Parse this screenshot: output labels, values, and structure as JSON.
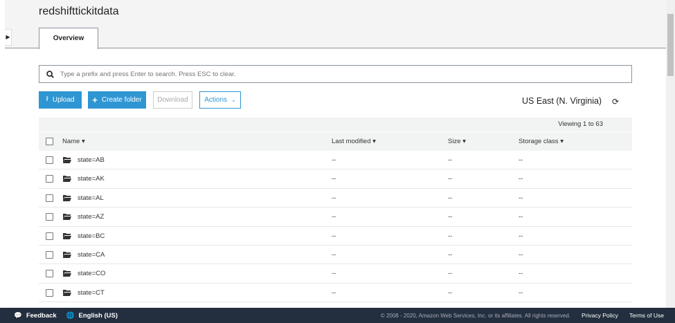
{
  "bucket": {
    "title": "redshifttickitdata",
    "tab": "Overview"
  },
  "search": {
    "placeholder": "Type a prefix and press Enter to search. Press ESC to clear."
  },
  "toolbar": {
    "upload": "Upload",
    "create_folder": "Create folder",
    "download": "Download",
    "actions": "Actions",
    "region": "US East (N. Virginia)"
  },
  "table": {
    "viewing": "Viewing 1 to 63",
    "columns": {
      "name": "Name",
      "last_modified": "Last modified",
      "size": "Size",
      "storage_class": "Storage class"
    },
    "rows": [
      {
        "name": "state=AB",
        "modified": "--",
        "size": "--",
        "storage": "--"
      },
      {
        "name": "state=AK",
        "modified": "--",
        "size": "--",
        "storage": "--"
      },
      {
        "name": "state=AL",
        "modified": "--",
        "size": "--",
        "storage": "--"
      },
      {
        "name": "state=AZ",
        "modified": "--",
        "size": "--",
        "storage": "--"
      },
      {
        "name": "state=BC",
        "modified": "--",
        "size": "--",
        "storage": "--"
      },
      {
        "name": "state=CA",
        "modified": "--",
        "size": "--",
        "storage": "--"
      },
      {
        "name": "state=CO",
        "modified": "--",
        "size": "--",
        "storage": "--"
      },
      {
        "name": "state=CT",
        "modified": "--",
        "size": "--",
        "storage": "--"
      }
    ]
  },
  "footer": {
    "feedback": "Feedback",
    "language": "English (US)",
    "copyright": "© 2008 - 2020, Amazon Web Services, Inc. or its affiliates. All rights reserved.",
    "privacy": "Privacy Policy",
    "terms": "Terms of Use"
  }
}
